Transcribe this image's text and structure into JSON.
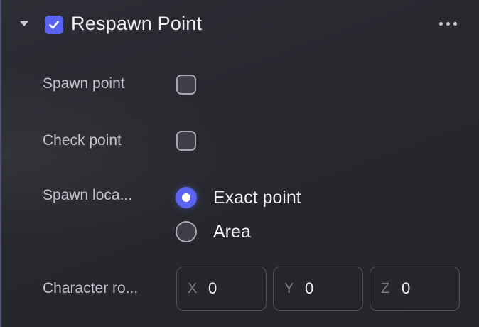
{
  "component": {
    "title": "Respawn Point",
    "enabled": true
  },
  "fields": {
    "spawn_point": {
      "label": "Spawn point",
      "checked": false
    },
    "check_point": {
      "label": "Check point",
      "checked": false
    },
    "spawn_location": {
      "label": "Spawn loca...",
      "options": [
        {
          "label": "Exact point",
          "selected": true
        },
        {
          "label": "Area",
          "selected": false
        }
      ]
    },
    "character_rotation": {
      "label": "Character ro...",
      "x": {
        "axis": "X",
        "value": "0"
      },
      "y": {
        "axis": "Y",
        "value": "0"
      },
      "z": {
        "axis": "Z",
        "value": "0"
      }
    }
  },
  "colors": {
    "accent": "#5a63f0",
    "background": "#27282e",
    "text": "#eef0f4",
    "muted_text": "#c3c5cd"
  },
  "icons": {
    "collapse": "chevron-down-icon",
    "enabled_check": "check-icon",
    "menu": "more-horizontal-icon"
  }
}
